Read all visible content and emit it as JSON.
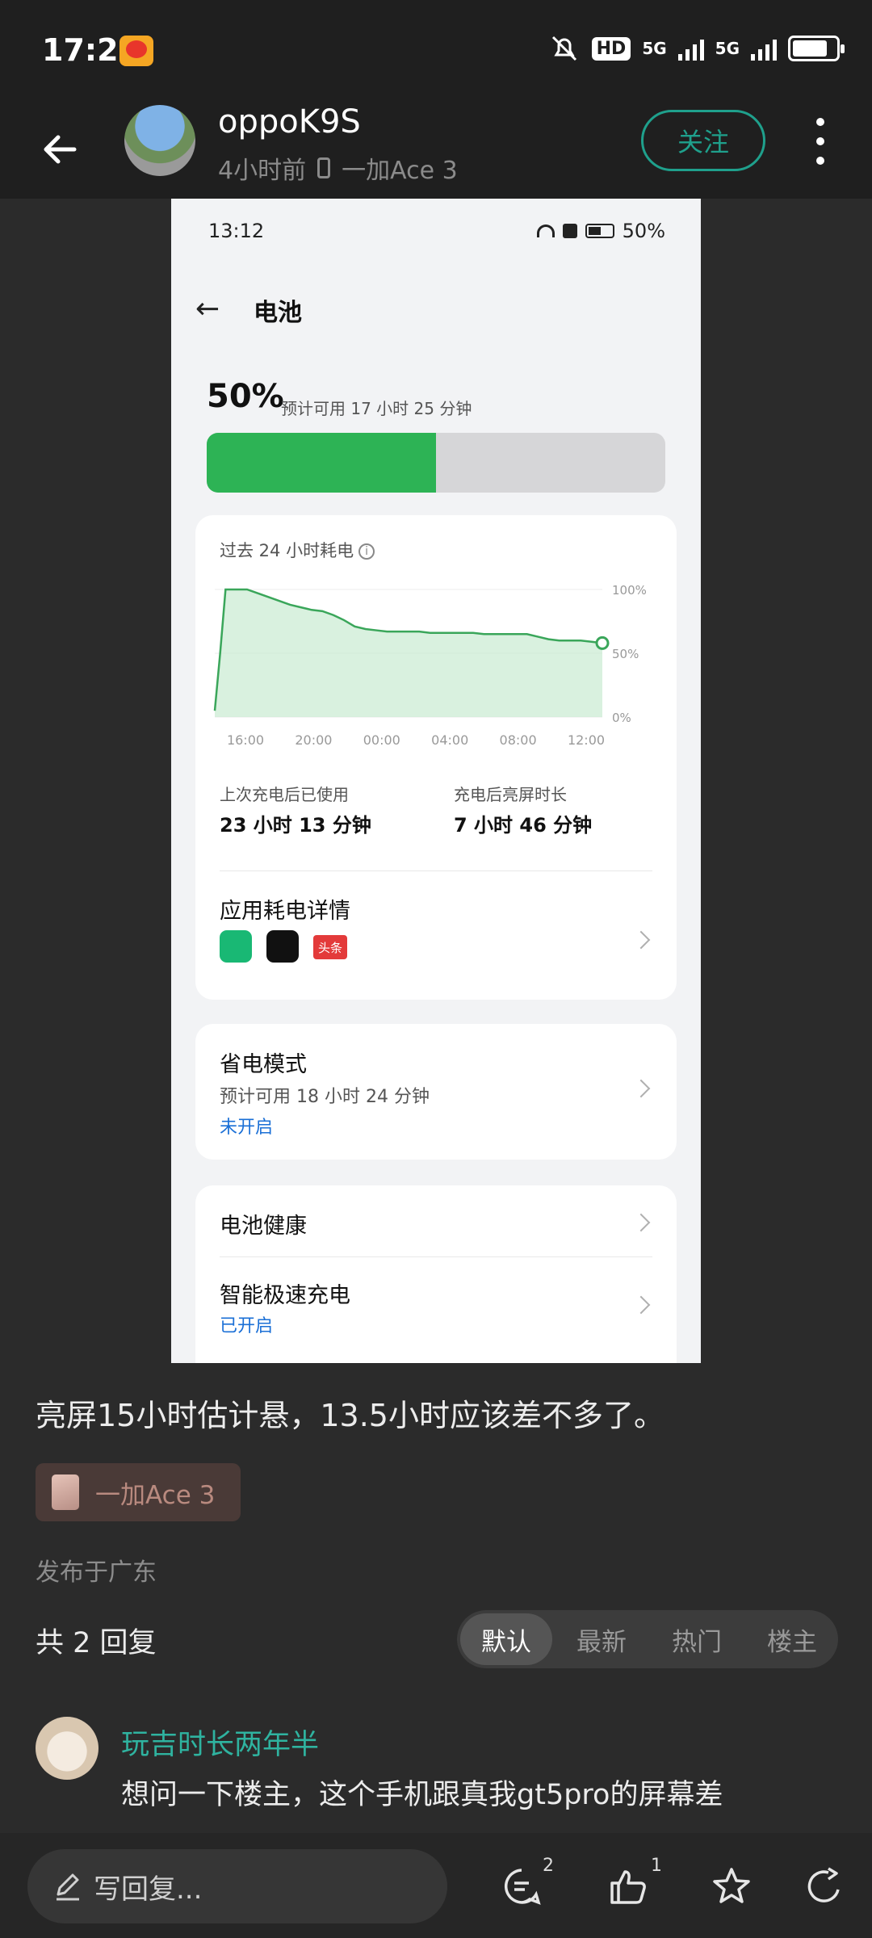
{
  "status_bar": {
    "time": "17:26",
    "hd_label": "HD",
    "net_label_1": "5G",
    "net_label_2": "5G",
    "battery_level": 0.8
  },
  "header": {
    "username": "oppoK9S",
    "time_ago": "4小时前",
    "device": "一加Ace 3",
    "follow_label": "关注"
  },
  "screenshot": {
    "status_time": "13:12",
    "status_battery": "50%",
    "title": "电池",
    "percent": "50%",
    "estimate": "预计可用 17 小时 25 分钟",
    "battery_level": 0.5,
    "usage_title": "过去 24 小时耗电",
    "chart_y_ticks": [
      "100%",
      "50%",
      "0%"
    ],
    "chart_x_ticks": [
      "16:00",
      "20:00",
      "00:00",
      "04:00",
      "08:00",
      "12:00"
    ],
    "used_label": "上次充电后已使用",
    "used_value": "23 小时 13 分钟",
    "screen_label": "充电后亮屏时长",
    "screen_value": "7 小时 46 分钟",
    "app_usage_label": "应用耗电详情",
    "app_badge_text": "头条",
    "power_save_title": "省电模式",
    "power_save_estimate": "预计可用 18 小时 24 分钟",
    "power_save_status": "未开启",
    "health_title": "电池健康",
    "fast_charge_title": "智能极速充电",
    "fast_charge_status": "已开启"
  },
  "chart_data": {
    "type": "area",
    "title": "过去 24 小时耗电",
    "x_ticks": [
      "16:00",
      "20:00",
      "00:00",
      "04:00",
      "08:00",
      "12:00"
    ],
    "y_ticks": [
      "100%",
      "50%",
      "0%"
    ],
    "ylim": [
      0,
      100
    ],
    "x": [
      0,
      0.5,
      1,
      2,
      3,
      4,
      5,
      6,
      7,
      8,
      9,
      10,
      11,
      12,
      13,
      14,
      15,
      16,
      17,
      18,
      19,
      20,
      21,
      22,
      23,
      24,
      25,
      26,
      27,
      28,
      29,
      30,
      31,
      32,
      33,
      34,
      35,
      36
    ],
    "values": [
      5,
      50,
      100,
      100,
      100,
      97,
      94,
      91,
      88,
      86,
      84,
      83,
      80,
      76,
      71,
      69,
      68,
      67,
      67,
      67,
      67,
      66,
      66,
      66,
      66,
      66,
      65,
      65,
      65,
      65,
      65,
      63,
      61,
      60,
      60,
      60,
      59,
      58
    ],
    "line_color": "#3aa65a",
    "fill_color": "#c9ebd1",
    "grid": true
  },
  "post": {
    "text": "亮屏15小时估计悬，13.5小时应该差不多了。",
    "device_tag": "一加Ace 3",
    "location": "发布于广东",
    "reply_count": "共 2 回复",
    "sort_tabs": [
      "默认",
      "最新",
      "热门",
      "楼主"
    ]
  },
  "comment": {
    "username": "玩吉时长两年半",
    "text": "想问一下楼主，这个手机跟真我gt5pro的屏幕差"
  },
  "bottom_bar": {
    "reply_placeholder": "写回复...",
    "comment_count": "2",
    "like_count": "1"
  },
  "colors": {
    "accent": "#1fa08c",
    "battery_green": "#2db355",
    "link_blue": "#1a6fd6"
  },
  "icons": [
    "back-arrow-icon",
    "more-icon",
    "wifi-icon",
    "battery-icon",
    "info-icon",
    "chevron-right-icon",
    "pen-icon",
    "comment-icon",
    "thumbs-up-icon",
    "star-icon",
    "share-icon"
  ]
}
